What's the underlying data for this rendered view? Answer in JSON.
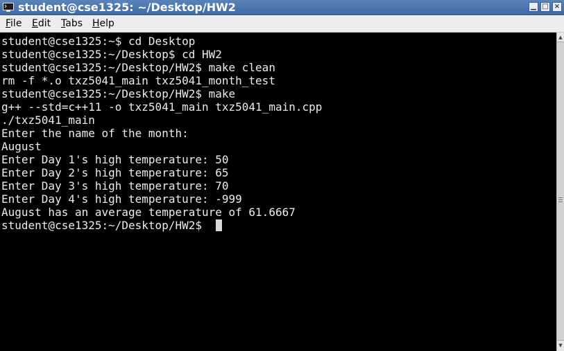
{
  "window": {
    "title": "student@cse1325: ~/Desktop/HW2",
    "icon": "terminal-icon",
    "controls": [
      "minimize",
      "maximize",
      "close"
    ]
  },
  "menu": {
    "items": [
      {
        "label": "File",
        "mnemonic": "F"
      },
      {
        "label": "Edit",
        "mnemonic": "E"
      },
      {
        "label": "Tabs",
        "mnemonic": "T"
      },
      {
        "label": "Help",
        "mnemonic": "H"
      }
    ]
  },
  "terminal": {
    "lines": [
      "student@cse1325:~$ cd Desktop",
      "student@cse1325:~/Desktop$ cd HW2",
      "student@cse1325:~/Desktop/HW2$ make clean",
      "rm -f *.o txz5041_main txz5041_month_test",
      "student@cse1325:~/Desktop/HW2$ make",
      "g++ --std=c++11 -o txz5041_main txz5041_main.cpp",
      "./txz5041_main",
      "Enter the name of the month:",
      "August",
      "Enter Day 1's high temperature: 50",
      "Enter Day 2's high temperature: 65",
      "Enter Day 3's high temperature: 70",
      "Enter Day 4's high temperature: -999",
      "August has an average temperature of 61.6667",
      "student@cse1325:~/Desktop/HW2$ "
    ]
  },
  "colors": {
    "titlebar": "#4a76ae",
    "terminal_bg": "#000000",
    "terminal_fg": "#ececec"
  }
}
